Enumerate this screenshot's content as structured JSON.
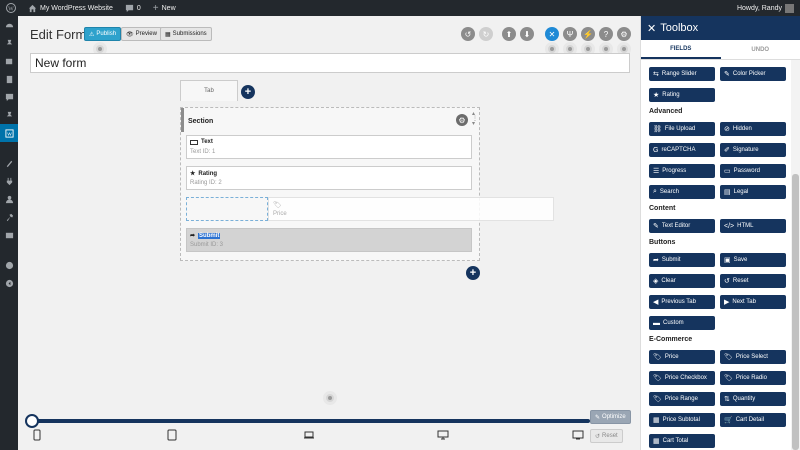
{
  "adminbar": {
    "site_name": "My WordPress Website",
    "comments_count": "0",
    "new_label": "New",
    "greeting": "Howdy, Randy"
  },
  "header": {
    "title": "Edit Form",
    "publish": "Publish",
    "preview": "Preview",
    "submissions": "Submissions"
  },
  "form": {
    "name": "New form",
    "tab_label": "Tab",
    "section_title": "Section",
    "fields": [
      {
        "name": "Text",
        "sub": "Text   ID: 1"
      },
      {
        "name": "Rating",
        "sub": "Rating   ID: 2"
      },
      {
        "name": "Submit",
        "sub": "Submit   ID: 3"
      }
    ],
    "dragging": {
      "name": "Price",
      "sub": "Price"
    }
  },
  "bottom": {
    "optimize": "Optimize",
    "reset": "Reset"
  },
  "toolbox": {
    "title": "Toolbox",
    "tab_fields": "FIELDS",
    "tab_undo": "UNDO",
    "top": [
      "Range Slider",
      "Color Picker",
      "Rating"
    ],
    "groups": {
      "advanced": "Advanced",
      "content": "Content",
      "buttons": "Buttons",
      "ecommerce": "E-Commerce"
    },
    "advanced": [
      "File Upload",
      "Hidden",
      "reCAPTCHA",
      "Signature",
      "Progress",
      "Password",
      "Search",
      "Legal"
    ],
    "content": [
      "Text Editor",
      "HTML"
    ],
    "buttons": [
      "Submit",
      "Save",
      "Clear",
      "Reset",
      "Previous Tab",
      "Next Tab",
      "Custom"
    ],
    "ecommerce": [
      "Price",
      "Price Select",
      "Price Checkbox",
      "Price Radio",
      "Price Range",
      "Quantity",
      "Price Subtotal",
      "Cart Detail",
      "Cart Total"
    ]
  },
  "colors": {
    "navy": "#15345e",
    "blue": "#2ea2cc",
    "adminbar": "#23282d"
  }
}
